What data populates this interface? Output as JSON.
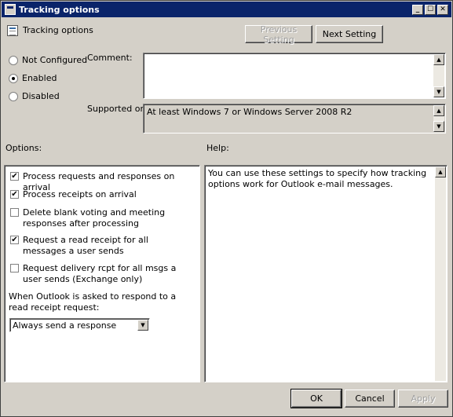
{
  "window": {
    "title": "Tracking options",
    "controls": {
      "minimize": "_",
      "maximize": "☐",
      "close": "✕"
    }
  },
  "header": {
    "icon": "policy-settings-icon",
    "title": "Tracking options",
    "previous_button": "Previous Setting",
    "next_button": "Next Setting"
  },
  "state": {
    "options": [
      {
        "label": "Not Configured",
        "selected": false
      },
      {
        "label": "Enabled",
        "selected": true
      },
      {
        "label": "Disabled",
        "selected": false
      }
    ]
  },
  "comment": {
    "label": "Comment:",
    "value": ""
  },
  "supported": {
    "label": "Supported on:",
    "value": "At least Windows 7 or Windows Server 2008 R2"
  },
  "options_panel": {
    "label": "Options:",
    "checkboxes": [
      {
        "label": "Process requests and responses on arrival",
        "checked": true
      },
      {
        "label": "Process receipts on arrival",
        "checked": true
      },
      {
        "label": "Delete blank voting and meeting responses after processing",
        "checked": false
      },
      {
        "label": "Request a read receipt for all messages a user sends",
        "checked": true
      },
      {
        "label": "Request delivery rcpt for all msgs a user sends (Exchange only)",
        "checked": false
      }
    ],
    "read_receipt_prompt": "When Outlook is asked to respond to a read receipt request:",
    "read_receipt_select": {
      "selected": "Always send a response"
    }
  },
  "help_panel": {
    "label": "Help:",
    "text": "You can use these settings to specify how tracking options work for Outlook e-mail messages."
  },
  "footer": {
    "ok": "OK",
    "cancel": "Cancel",
    "apply": "Apply"
  },
  "glyphs": {
    "check": "✔",
    "arrow_up": "▲",
    "arrow_down": "▼"
  }
}
